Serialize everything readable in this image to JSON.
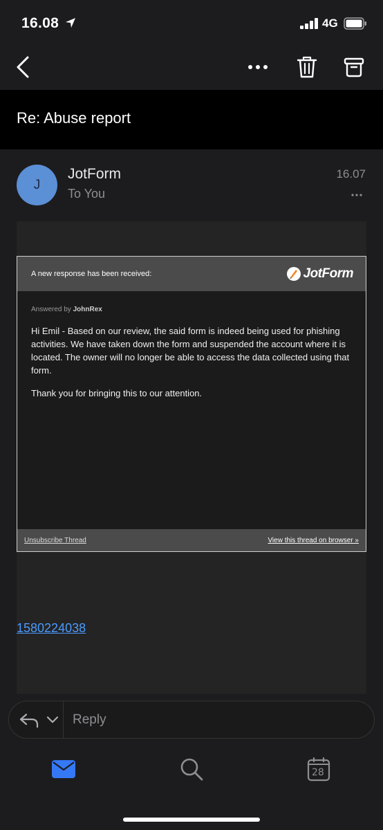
{
  "status_bar": {
    "time": "16.08",
    "network": "4G"
  },
  "icons": {
    "back": "chevron-left-icon",
    "more": "ellipsis-icon",
    "delete": "trash-icon",
    "archive": "archive-box-icon",
    "reply": "reply-arrow-icon",
    "mail": "envelope-icon",
    "search": "magnifier-icon",
    "calendar": "calendar-icon"
  },
  "colors": {
    "accent": "#3478f6",
    "link": "#4a9bff",
    "avatar": "#5b8fd6"
  },
  "message": {
    "subject": "Re: Abuse report",
    "sender": "JotForm",
    "avatar_letter": "J",
    "recipient": "To You",
    "time": "16.07"
  },
  "email": {
    "header_text": "A new response has been received:",
    "logo_text": "JotForm",
    "answered_prefix": "Answered by",
    "answered_by": "JohnRex",
    "paragraph1": "Hi Emil - Based on our review, the said form is indeed being used for phishing activities. We have taken down the form and suspended the account where it is located. The owner will no longer be able to access the data collected using that form.",
    "paragraph2": "Thank you for bringing this to our attention.",
    "unsubscribe_label": "Unsubscribe Thread",
    "view_thread_label": "View this thread on browser »",
    "ticket_id": "1580224038"
  },
  "reply_bar": {
    "placeholder": "Reply"
  },
  "tabs": {
    "calendar_day": "28",
    "active": "mail"
  }
}
